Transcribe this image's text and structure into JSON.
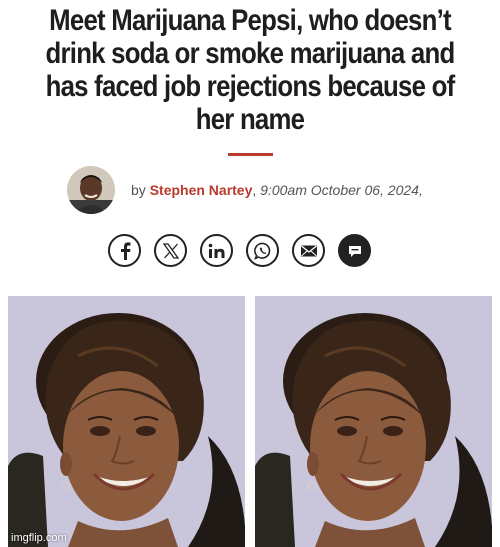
{
  "article": {
    "headline_lines": [
      "Meet Marijuana Pepsi, who doesn’t",
      "drink soda or smoke marijuana and",
      "has faced job rejections because of",
      "her name"
    ],
    "byline": {
      "prefix": "by",
      "author": "Stephen Nartey",
      "separator": ",",
      "timestamp": "9:00am October 06, 2024,"
    }
  },
  "share_buttons": [
    {
      "icon": "facebook-icon"
    },
    {
      "icon": "x-twitter-icon"
    },
    {
      "icon": "linkedin-icon"
    },
    {
      "icon": "whatsapp-icon"
    },
    {
      "icon": "email-icon"
    },
    {
      "icon": "comment-icon"
    }
  ],
  "watermark": "imgflip.com",
  "colors": {
    "accent": "#b53b2e",
    "author_link": "#b83a2e",
    "headline": "#1e1e1e",
    "photo_background": "#c9c6dc"
  }
}
